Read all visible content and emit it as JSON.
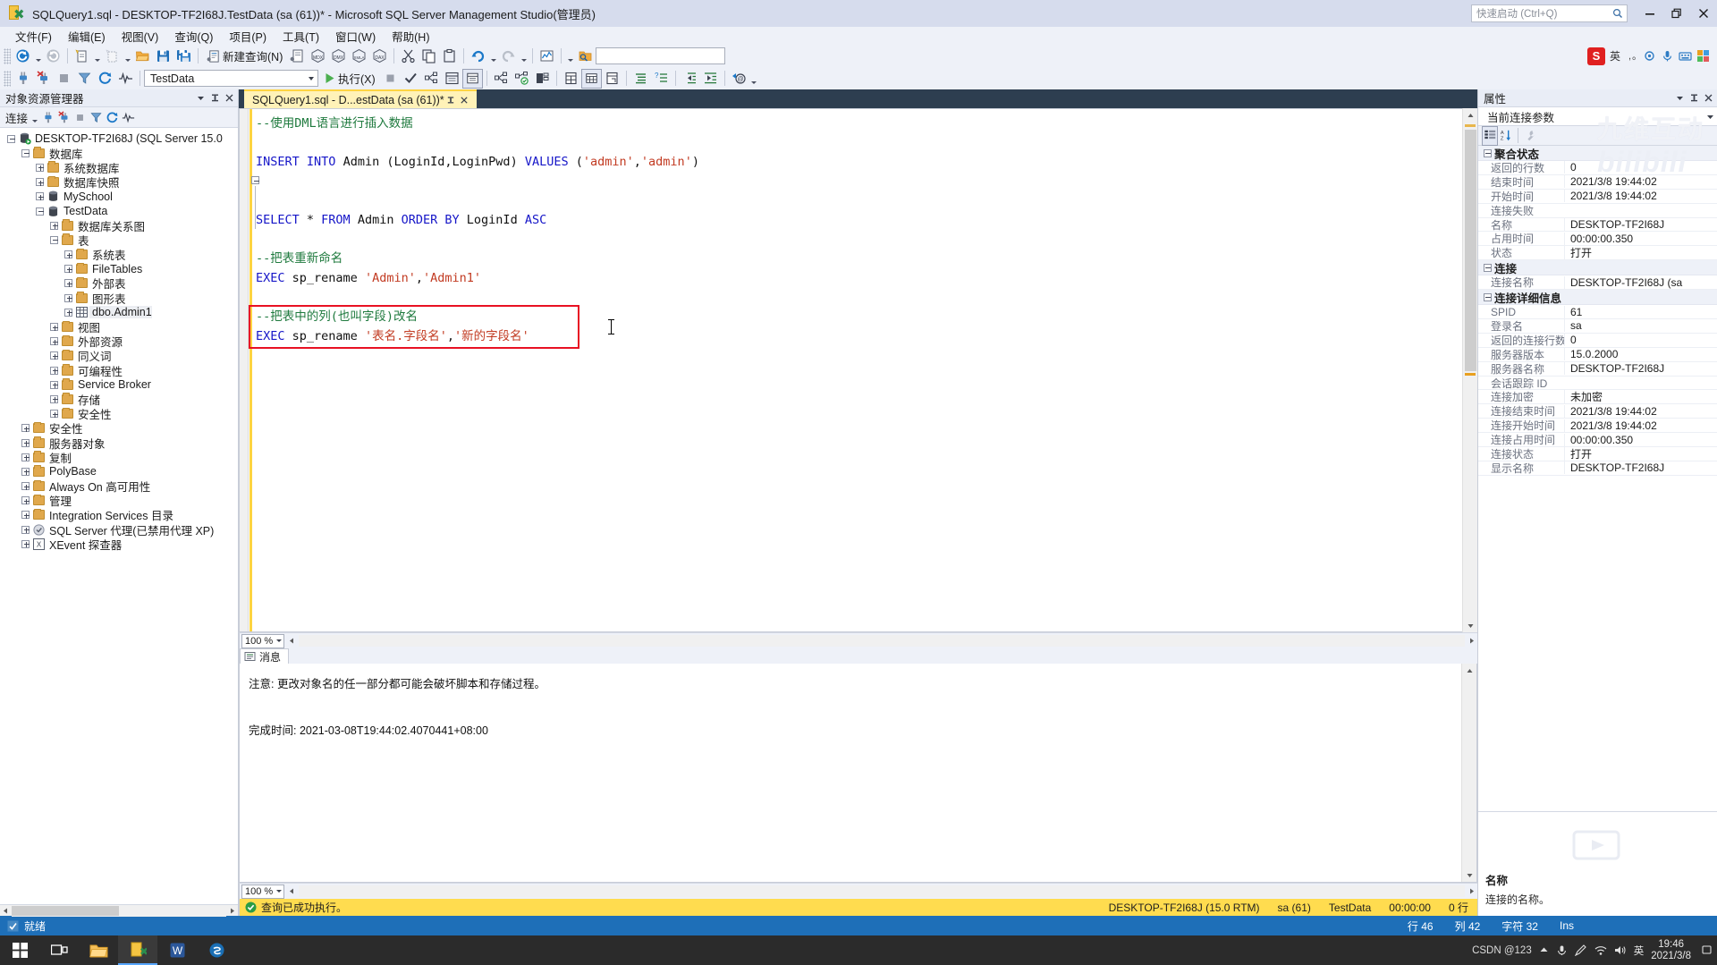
{
  "window": {
    "title": "SQLQuery1.sql - DESKTOP-TF2I68J.TestData (sa (61))* - Microsoft SQL Server Management Studio(管理员)",
    "app_icon": "ssms-icon",
    "minimize": "minimize-button",
    "restore": "restore-button",
    "close": "close-button"
  },
  "quick_launch": {
    "placeholder": "快速启动 (Ctrl+Q)",
    "value": ""
  },
  "menu": {
    "items": [
      "文件(F)",
      "编辑(E)",
      "视图(V)",
      "查询(Q)",
      "项目(P)",
      "工具(T)",
      "窗口(W)",
      "帮助(H)"
    ]
  },
  "toolbar1": {
    "new_query_label": "新建查询(N)"
  },
  "toolbar2": {
    "database": "TestData",
    "execute_label": "执行(X)"
  },
  "ime": {
    "lang": "英",
    "logo": "S"
  },
  "watermark": {
    "line1": "九维互动",
    "line2": "bilibili"
  },
  "object_explorer": {
    "title": "对象资源管理器",
    "connect_label": "连接",
    "nodes": [
      {
        "label": "DESKTOP-TF2I68J (SQL Server 15.0",
        "indent": 0,
        "icon": "server-icon",
        "state": "minus"
      },
      {
        "label": "数据库",
        "indent": 1,
        "icon": "folder-icon",
        "state": "minus"
      },
      {
        "label": "系统数据库",
        "indent": 2,
        "icon": "folder-icon",
        "state": "plus"
      },
      {
        "label": "数据库快照",
        "indent": 2,
        "icon": "folder-icon",
        "state": "plus"
      },
      {
        "label": "MySchool",
        "indent": 2,
        "icon": "database-icon",
        "state": "plus"
      },
      {
        "label": "TestData",
        "indent": 2,
        "icon": "database-icon",
        "state": "minus"
      },
      {
        "label": "数据库关系图",
        "indent": 3,
        "icon": "folder-icon",
        "state": "plus"
      },
      {
        "label": "表",
        "indent": 3,
        "icon": "folder-icon",
        "state": "minus"
      },
      {
        "label": "系统表",
        "indent": 4,
        "icon": "folder-icon",
        "state": "plus"
      },
      {
        "label": "FileTables",
        "indent": 4,
        "icon": "folder-icon",
        "state": "plus"
      },
      {
        "label": "外部表",
        "indent": 4,
        "icon": "folder-icon",
        "state": "plus"
      },
      {
        "label": "图形表",
        "indent": 4,
        "icon": "folder-icon",
        "state": "plus"
      },
      {
        "label": "dbo.Admin1",
        "indent": 4,
        "icon": "table-icon",
        "state": "plus",
        "selected": true
      },
      {
        "label": "视图",
        "indent": 3,
        "icon": "folder-icon",
        "state": "plus"
      },
      {
        "label": "外部资源",
        "indent": 3,
        "icon": "folder-icon",
        "state": "plus"
      },
      {
        "label": "同义词",
        "indent": 3,
        "icon": "folder-icon",
        "state": "plus"
      },
      {
        "label": "可编程性",
        "indent": 3,
        "icon": "folder-icon",
        "state": "plus"
      },
      {
        "label": "Service Broker",
        "indent": 3,
        "icon": "folder-icon",
        "state": "plus"
      },
      {
        "label": "存储",
        "indent": 3,
        "icon": "folder-icon",
        "state": "plus"
      },
      {
        "label": "安全性",
        "indent": 3,
        "icon": "folder-icon",
        "state": "plus"
      },
      {
        "label": "安全性",
        "indent": 1,
        "icon": "folder-icon",
        "state": "plus"
      },
      {
        "label": "服务器对象",
        "indent": 1,
        "icon": "folder-icon",
        "state": "plus"
      },
      {
        "label": "复制",
        "indent": 1,
        "icon": "folder-icon",
        "state": "plus"
      },
      {
        "label": "PolyBase",
        "indent": 1,
        "icon": "folder-icon",
        "state": "plus"
      },
      {
        "label": "Always On 高可用性",
        "indent": 1,
        "icon": "folder-icon",
        "state": "plus"
      },
      {
        "label": "管理",
        "indent": 1,
        "icon": "folder-icon",
        "state": "plus"
      },
      {
        "label": "Integration Services 目录",
        "indent": 1,
        "icon": "folder-icon",
        "state": "plus"
      },
      {
        "label": "SQL Server 代理(已禁用代理 XP)",
        "indent": 1,
        "icon": "agent-icon",
        "state": "plus"
      },
      {
        "label": "XEvent 探查器",
        "indent": 1,
        "icon": "xevent-icon",
        "state": "plus"
      }
    ]
  },
  "document_tab": {
    "label": "SQLQuery1.sql - D...estData (sa (61))*",
    "pin": "pin-icon",
    "close": "close-icon"
  },
  "editor": {
    "zoom": "100 %",
    "lines": [
      {
        "type": "comment",
        "text": "--使用DML语言进行插入数据"
      },
      {
        "type": "blank",
        "text": ""
      },
      {
        "type": "code",
        "text": "INSERT INTO Admin (LoginId,LoginPwd) VALUES ('admin','admin')"
      },
      {
        "type": "blank",
        "text": ""
      },
      {
        "type": "blank",
        "text": ""
      },
      {
        "type": "code",
        "text": "SELECT * FROM Admin ORDER BY LoginId ASC"
      },
      {
        "type": "blank",
        "text": ""
      },
      {
        "type": "comment",
        "text": "--把表重新命名"
      },
      {
        "type": "code",
        "text": "EXEC sp_rename 'Admin','Admin1'"
      },
      {
        "type": "blank",
        "text": ""
      },
      {
        "type": "comment",
        "text": "--把表中的列(也叫字段)改名"
      },
      {
        "type": "code",
        "text": "EXEC sp_rename '表名.字段名','新的字段名'"
      }
    ],
    "highlight_box": "red-annotation-box"
  },
  "results": {
    "tab_label": "消息",
    "zoom": "100 %",
    "message_lines": [
      "注意: 更改对象名的任一部分都可能会破坏脚本和存储过程。",
      "",
      "完成时间: 2021-03-08T19:44:02.4070441+08:00"
    ]
  },
  "editor_status": {
    "message": "查询已成功执行。",
    "server": "DESKTOP-TF2I68J (15.0 RTM)",
    "login": "sa (61)",
    "database": "TestData",
    "elapsed": "00:00:00",
    "rows": "0 行"
  },
  "properties": {
    "title": "属性",
    "selector": "当前连接参数",
    "groups": [
      {
        "name": "聚合状态",
        "rows": [
          {
            "key": "返回的行数",
            "value": "0"
          },
          {
            "key": "结束时间",
            "value": "2021/3/8 19:44:02"
          },
          {
            "key": "开始时间",
            "value": "2021/3/8 19:44:02"
          },
          {
            "key": "连接失败",
            "value": ""
          },
          {
            "key": "名称",
            "value": "DESKTOP-TF2I68J"
          },
          {
            "key": "占用时间",
            "value": "00:00:00.350"
          },
          {
            "key": "状态",
            "value": "打开"
          }
        ]
      },
      {
        "name": "连接",
        "rows": [
          {
            "key": "连接名称",
            "value": "DESKTOP-TF2I68J (sa"
          }
        ]
      },
      {
        "name": "连接详细信息",
        "rows": [
          {
            "key": "SPID",
            "value": "61"
          },
          {
            "key": "登录名",
            "value": "sa"
          },
          {
            "key": "返回的连接行数",
            "value": "0"
          },
          {
            "key": "服务器版本",
            "value": "15.0.2000"
          },
          {
            "key": "服务器名称",
            "value": "DESKTOP-TF2I68J"
          },
          {
            "key": "会话跟踪 ID",
            "value": ""
          },
          {
            "key": "连接加密",
            "value": "未加密"
          },
          {
            "key": "连接结束时间",
            "value": "2021/3/8 19:44:02"
          },
          {
            "key": "连接开始时间",
            "value": "2021/3/8 19:44:02"
          },
          {
            "key": "连接占用时间",
            "value": "00:00:00.350"
          },
          {
            "key": "连接状态",
            "value": "打开"
          },
          {
            "key": "显示名称",
            "value": "DESKTOP-TF2I68J"
          }
        ]
      }
    ],
    "footer_title": "名称",
    "footer_desc": "连接的名称。"
  },
  "app_status": {
    "ready": "就绪",
    "line": "行 46",
    "column": "列 42",
    "char": "字符 32",
    "insert": "Ins"
  },
  "taskbar": {
    "start": "start-button",
    "items": [
      "task-view-icon",
      "file-explorer-icon",
      "ssms-icon",
      "word-icon",
      "ssms-icon-2"
    ],
    "clock_time": "19:46",
    "clock_date": "2021/3/8",
    "tray_lang": "英",
    "watermark": "CSDN @123"
  },
  "colors": {
    "title_bar": "#d6dced",
    "accent_blue": "#1e6fb8",
    "tab_yellow": "#fff2b8",
    "status_yellow": "#ffdc4f",
    "comment_green": "#1f7a3e",
    "keyword_blue": "#1616c8",
    "string_red": "#c23b22",
    "annotation_red": "#e81123",
    "tabstrip_dark": "#2d3e50"
  }
}
